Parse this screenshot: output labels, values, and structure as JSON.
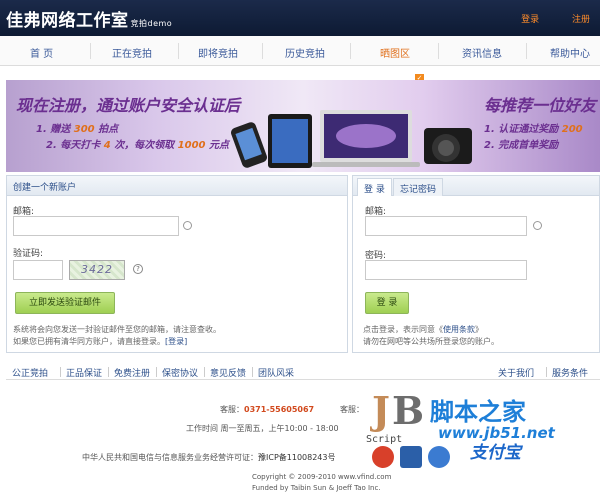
{
  "header": {
    "logo": "佳弗网络工作室",
    "logo_sub": "竞拍demo",
    "login": "登录",
    "register": "注册"
  },
  "nav": {
    "items": [
      "首 页",
      "正在竞拍",
      "即将竞拍",
      "历史竞拍",
      "晒图区",
      "资讯信息",
      "帮助中心"
    ],
    "active_index": 4
  },
  "banner": {
    "title": "现在注册，通过账户安全认证后",
    "line1_pre": "1. 赠送",
    "line1_em": "300",
    "line1_post": "拍点",
    "line2_pre": "2. 每天打卡",
    "line2_em1": "4",
    "line2_mid": "次，每次领取",
    "line2_em2": "1000",
    "line2_post": "元点",
    "right_title": "每推荐一位好友",
    "right_line1_pre": "1. 认证通过奖励",
    "right_line1_em": "200",
    "right_line2": "2. 完成首单奖励"
  },
  "register": {
    "title": "创建一个新账户",
    "email_label": "邮箱:",
    "captcha_label": "验证码:",
    "captcha_text": "3422",
    "send_button": "立即发送验证邮件",
    "note1": "系统将会向您发送一封验证邮件至您的邮箱，请注意查收。",
    "note2_pre": "如果您已拥有清华同方账户，请直接登录。",
    "note2_link": "[登录]"
  },
  "login": {
    "tab_login": "登 录",
    "tab_forgot": "忘记密码",
    "email_label": "邮箱:",
    "password_label": "密码:",
    "login_button": "登 录",
    "note1_pre": "点击登录，表示同意《",
    "note1_link": "使用条款",
    "note1_post": "》",
    "note2": "请勿在网吧等公共场所登录您的账户。"
  },
  "footer_links": {
    "left": [
      "公正竞拍",
      "正品保证",
      "免费注册",
      "保密协议",
      "意见反馈",
      "团队风采"
    ],
    "right": [
      "关于我们",
      "服务条件"
    ]
  },
  "footer": {
    "hotline_label": "客服：",
    "hotline": "0371-55605067",
    "hotline2_label": "客服：",
    "hours": "工作时间 周一至周五，上午10:00 - 18:00",
    "icp_pre": "中华人民共和国电信与信息服务业务经营许可证：",
    "icp": "豫ICP备11008243号",
    "copyright": "Copyright © 2009-2010 www.vfind.com",
    "powered": "Funded by Taibin Sun & Joeff Tao Inc.",
    "alipay": "支付宝"
  },
  "watermark": {
    "jb": "JB",
    "script": "Script",
    "site_cn": "脚本之家",
    "site_url": "www.jb51.net"
  }
}
